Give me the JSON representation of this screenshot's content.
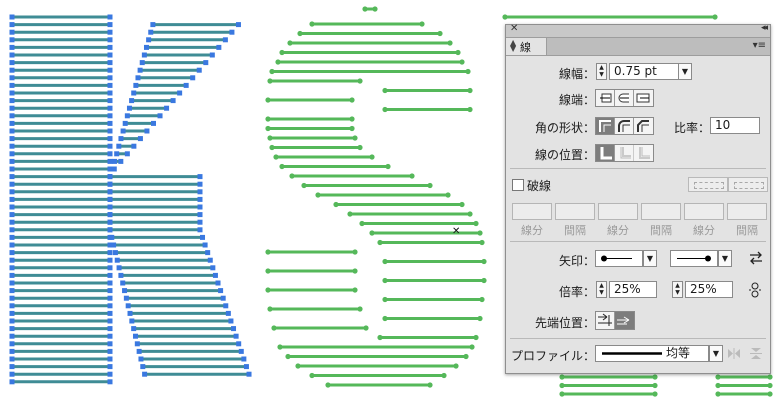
{
  "panel": {
    "close_glyph": "✕",
    "collapse_glyph": "◂◂",
    "tab_label": "線",
    "menu_glyph": "▾≡",
    "weight": {
      "label": "線幅：",
      "value": "0.75 pt"
    },
    "cap": {
      "label": "線端："
    },
    "corner": {
      "label": "角の形状：",
      "limit_label": "比率：",
      "limit_value": "10"
    },
    "align": {
      "label": "線の位置："
    },
    "dashed": {
      "label": "破線",
      "checked": false,
      "field_labels": [
        "線分",
        "間隔",
        "線分",
        "間隔",
        "線分",
        "間隔"
      ]
    },
    "arrowheads": {
      "label": "矢印："
    },
    "scale": {
      "label": "倍率：",
      "start": "25%",
      "end": "25%"
    },
    "align_arrow": {
      "label": "先端位置："
    },
    "profile": {
      "label": "プロファイル：",
      "value": "均等"
    }
  },
  "colors": {
    "green": "#55b85a",
    "blue": "#3a78e0",
    "teal": "#3f8c95",
    "panel_bg": "#e3e3e3"
  }
}
